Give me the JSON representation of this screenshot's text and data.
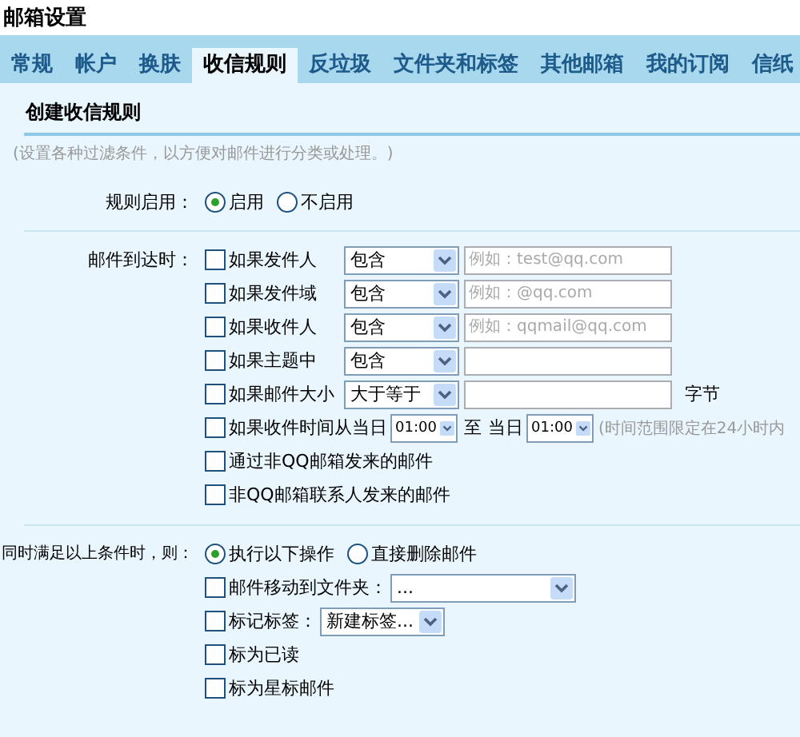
{
  "window": {
    "title": "邮箱设置"
  },
  "tabs": [
    {
      "label": "常规",
      "selected": false
    },
    {
      "label": "帐户",
      "selected": false
    },
    {
      "label": "换肤",
      "selected": false
    },
    {
      "label": "收信规则",
      "selected": true
    },
    {
      "label": "反垃圾",
      "selected": false
    },
    {
      "label": "文件夹和标签",
      "selected": false
    },
    {
      "label": "其他邮箱",
      "selected": false
    },
    {
      "label": "我的订阅",
      "selected": false
    },
    {
      "label": "信纸",
      "selected": false
    }
  ],
  "section_title": "创建收信规则",
  "hint": "(设置各种过滤条件，以方便对邮件进行分类或处理。)",
  "enable": {
    "label": "规则启用：",
    "options": [
      {
        "label": "启用",
        "selected": true
      },
      {
        "label": "不启用",
        "selected": false
      }
    ]
  },
  "conditions": {
    "label": "邮件到达时：",
    "rows": [
      {
        "kind": "match",
        "checked": false,
        "label": "如果发件人",
        "operator": "包含",
        "placeholder": "例如：test@qq.com"
      },
      {
        "kind": "match",
        "checked": false,
        "label": "如果发件域",
        "operator": "包含",
        "placeholder": "例如：@qq.com"
      },
      {
        "kind": "match",
        "checked": false,
        "label": "如果收件人",
        "operator": "包含",
        "placeholder": "例如：qqmail@qq.com"
      },
      {
        "kind": "match",
        "checked": false,
        "label": "如果主题中",
        "operator": "包含"
      },
      {
        "kind": "match",
        "checked": false,
        "label": "如果邮件大小",
        "operator": "大于等于",
        "unit": "字节"
      },
      {
        "kind": "time",
        "checked": false,
        "label": "如果收件时间从当日",
        "from": "01:00",
        "to_label": "至",
        "day_label": "当日",
        "to": "01:00",
        "note": "(时间范围限定在24小时内"
      },
      {
        "kind": "plain",
        "checked": false,
        "label": "通过非QQ邮箱发来的邮件"
      },
      {
        "kind": "plain",
        "checked": false,
        "label": "非QQ邮箱联系人发来的邮件"
      }
    ]
  },
  "actions": {
    "label": "同时满足以上条件时，则：",
    "modes": [
      {
        "label": "执行以下操作",
        "selected": true
      },
      {
        "label": "直接删除邮件",
        "selected": false
      }
    ],
    "rows": [
      {
        "kind": "folder",
        "checked": false,
        "label": "邮件移动到文件夹：",
        "value": "..."
      },
      {
        "kind": "tag",
        "checked": false,
        "label": "标记标签：",
        "value": "新建标签..."
      },
      {
        "kind": "plain",
        "checked": false,
        "label": "标为已读"
      },
      {
        "kind": "plain",
        "checked": false,
        "label": "标为星标邮件"
      }
    ]
  }
}
